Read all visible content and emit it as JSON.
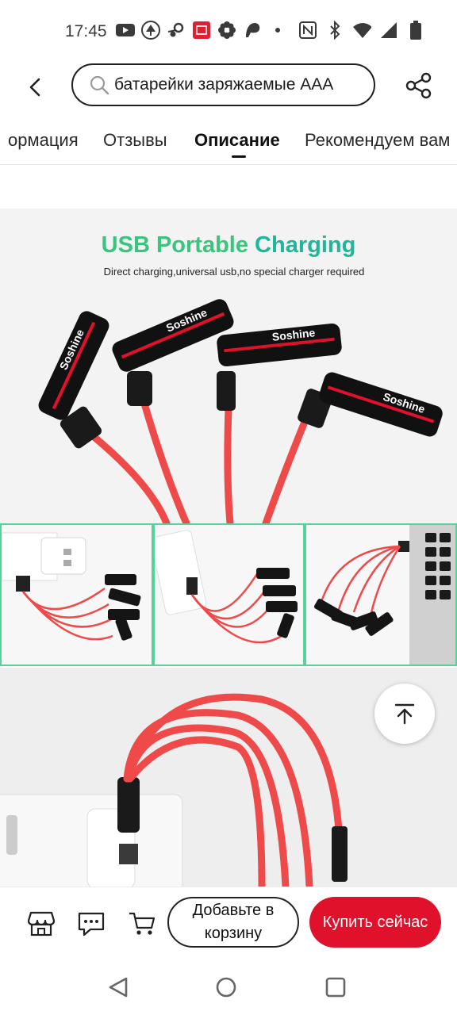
{
  "status_bar": {
    "time": "17:45",
    "icons": [
      "youtube-icon",
      "tree-icon",
      "steam-icon",
      "calendar-app-icon",
      "flower-icon",
      "p-icon",
      "dot-icon"
    ],
    "right_icons": [
      "nfc-icon",
      "bluetooth-icon",
      "wifi-icon",
      "signal-icon",
      "battery-icon"
    ]
  },
  "search": {
    "query": "батарейки заряжаемые AAA"
  },
  "tabs": [
    {
      "label": "ормация"
    },
    {
      "label": "Отзывы"
    },
    {
      "label": "Описание"
    },
    {
      "label": "Рекомендуем вам"
    }
  ],
  "active_tab": "Описание",
  "hero": {
    "title_part1": "USB Portable ",
    "title_part2": "Charging",
    "subtitle": "Direct charging,universal usb,no special charger required",
    "brand": "Soshine"
  },
  "actions": {
    "add_to_cart": "Добавьте в корзину",
    "buy_now": "Купить сейчас"
  },
  "colors": {
    "accent_red": "#e0112b",
    "title_green": "#3ac47d",
    "cable_red": "#ef4a4a"
  }
}
